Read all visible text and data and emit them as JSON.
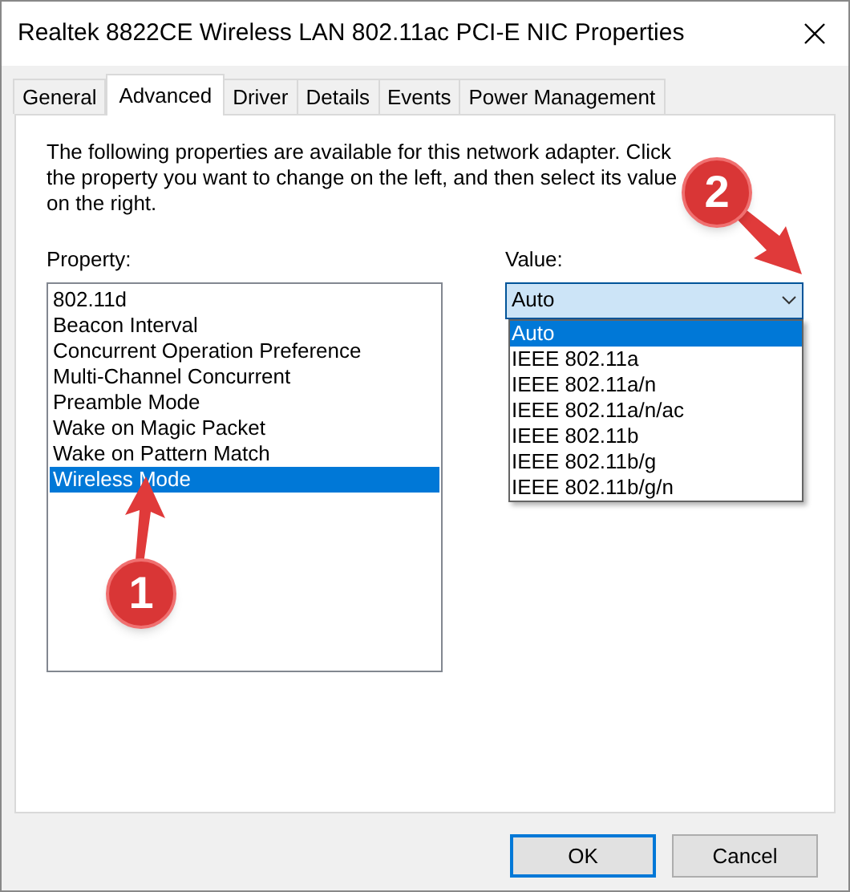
{
  "window": {
    "title": "Realtek 8822CE Wireless LAN 802.11ac PCI-E NIC Properties"
  },
  "tabs": [
    {
      "label": "General",
      "selected": false
    },
    {
      "label": "Advanced",
      "selected": true
    },
    {
      "label": "Driver",
      "selected": false
    },
    {
      "label": "Details",
      "selected": false
    },
    {
      "label": "Events",
      "selected": false
    },
    {
      "label": "Power Management",
      "selected": false
    }
  ],
  "description": "The following properties are available for this network adapter. Click the property you want to change on the left, and then select its value on the right.",
  "property": {
    "label": "Property:",
    "items": [
      {
        "label": "802.11d",
        "selected": false
      },
      {
        "label": "Beacon Interval",
        "selected": false
      },
      {
        "label": "Concurrent Operation Preference",
        "selected": false
      },
      {
        "label": "Multi-Channel Concurrent",
        "selected": false
      },
      {
        "label": "Preamble Mode",
        "selected": false
      },
      {
        "label": "Wake on Magic Packet",
        "selected": false
      },
      {
        "label": "Wake on Pattern Match",
        "selected": false
      },
      {
        "label": "Wireless Mode",
        "selected": true
      }
    ]
  },
  "value": {
    "label": "Value:",
    "current": "Auto",
    "expanded": true,
    "options": [
      {
        "label": "Auto",
        "selected": true
      },
      {
        "label": "IEEE 802.11a",
        "selected": false
      },
      {
        "label": "IEEE 802.11a/n",
        "selected": false
      },
      {
        "label": "IEEE 802.11a/n/ac",
        "selected": false
      },
      {
        "label": "IEEE 802.11b",
        "selected": false
      },
      {
        "label": "IEEE 802.11b/g",
        "selected": false
      },
      {
        "label": "IEEE 802.11b/g/n",
        "selected": false
      }
    ]
  },
  "annotations": [
    {
      "label": "1"
    },
    {
      "label": "2"
    }
  ],
  "buttons": [
    {
      "label": "OK",
      "kind": "default"
    },
    {
      "label": "Cancel",
      "kind": "normal"
    }
  ]
}
